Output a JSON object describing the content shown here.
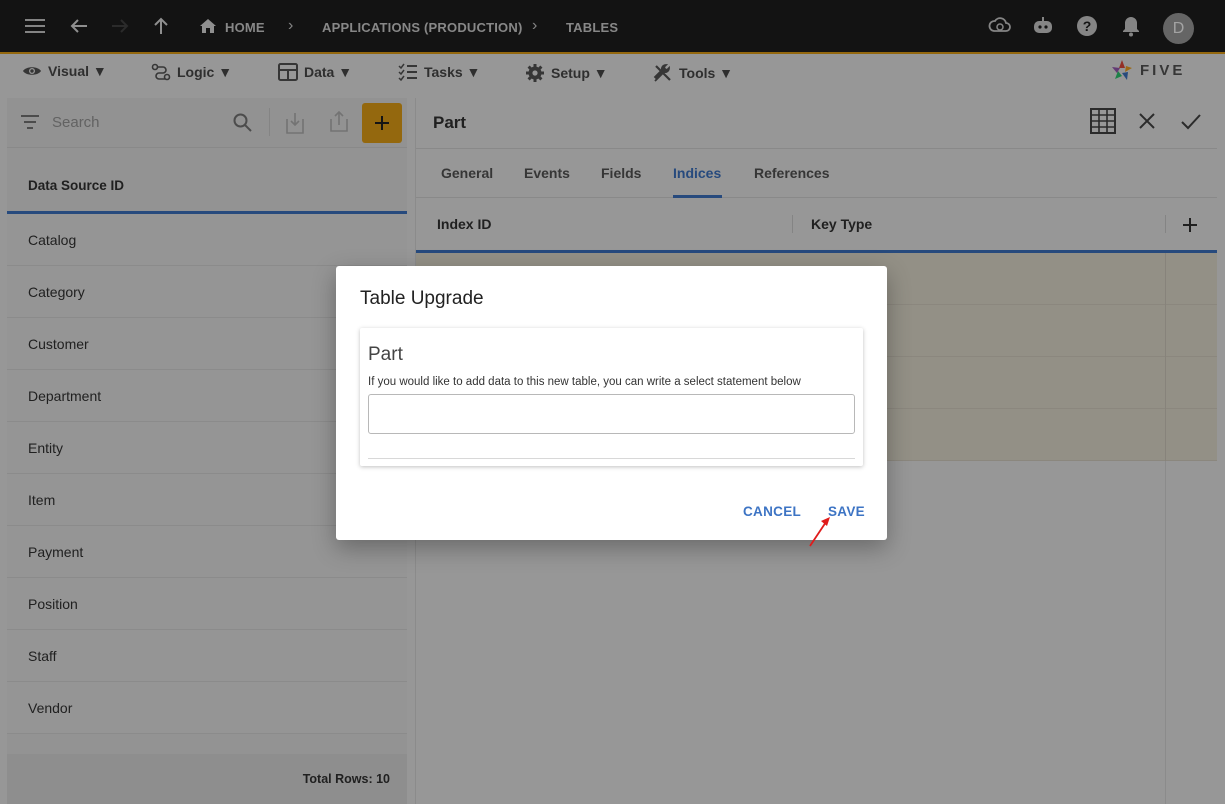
{
  "topbar": {
    "breadcrumbs": [
      "HOME",
      "APPLICATIONS (PRODUCTION)",
      "TABLES"
    ],
    "avatar_letter": "D",
    "bg_color": "#1f1f1f",
    "accent_color": "#e8a317"
  },
  "menubar": {
    "items": [
      {
        "label": "Visual ▼",
        "icon": "eye-icon"
      },
      {
        "label": "Logic ▼",
        "icon": "logic-icon"
      },
      {
        "label": "Data ▼",
        "icon": "table-icon"
      },
      {
        "label": "Tasks ▼",
        "icon": "tasks-icon"
      },
      {
        "label": "Setup ▼",
        "icon": "gear-icon"
      },
      {
        "label": "Tools ▼",
        "icon": "tools-icon"
      }
    ],
    "logo_text": "FIVE"
  },
  "left_panel": {
    "search_placeholder": "Search",
    "column_header": "Data Source ID",
    "items": [
      "Catalog",
      "Category",
      "Customer",
      "Department",
      "Entity",
      "Item",
      "Payment",
      "Position",
      "Staff",
      "Vendor"
    ],
    "footer": "Total Rows: 10"
  },
  "right_panel": {
    "title": "Part",
    "tabs": [
      "General",
      "Events",
      "Fields",
      "Indices",
      "References"
    ],
    "active_tab": "Indices",
    "columns": [
      "Index ID",
      "Key Type"
    ]
  },
  "dialog": {
    "title": "Table Upgrade",
    "card_title": "Part",
    "description": "If you would like to add data to this new table, you can write a select statement below",
    "input_value": "",
    "cancel_label": "CANCEL",
    "save_label": "SAVE"
  },
  "colors": {
    "primary_blue": "#3d74c4",
    "accent_orange": "#e8a317",
    "annotation_arrow": "#e01b1b"
  }
}
